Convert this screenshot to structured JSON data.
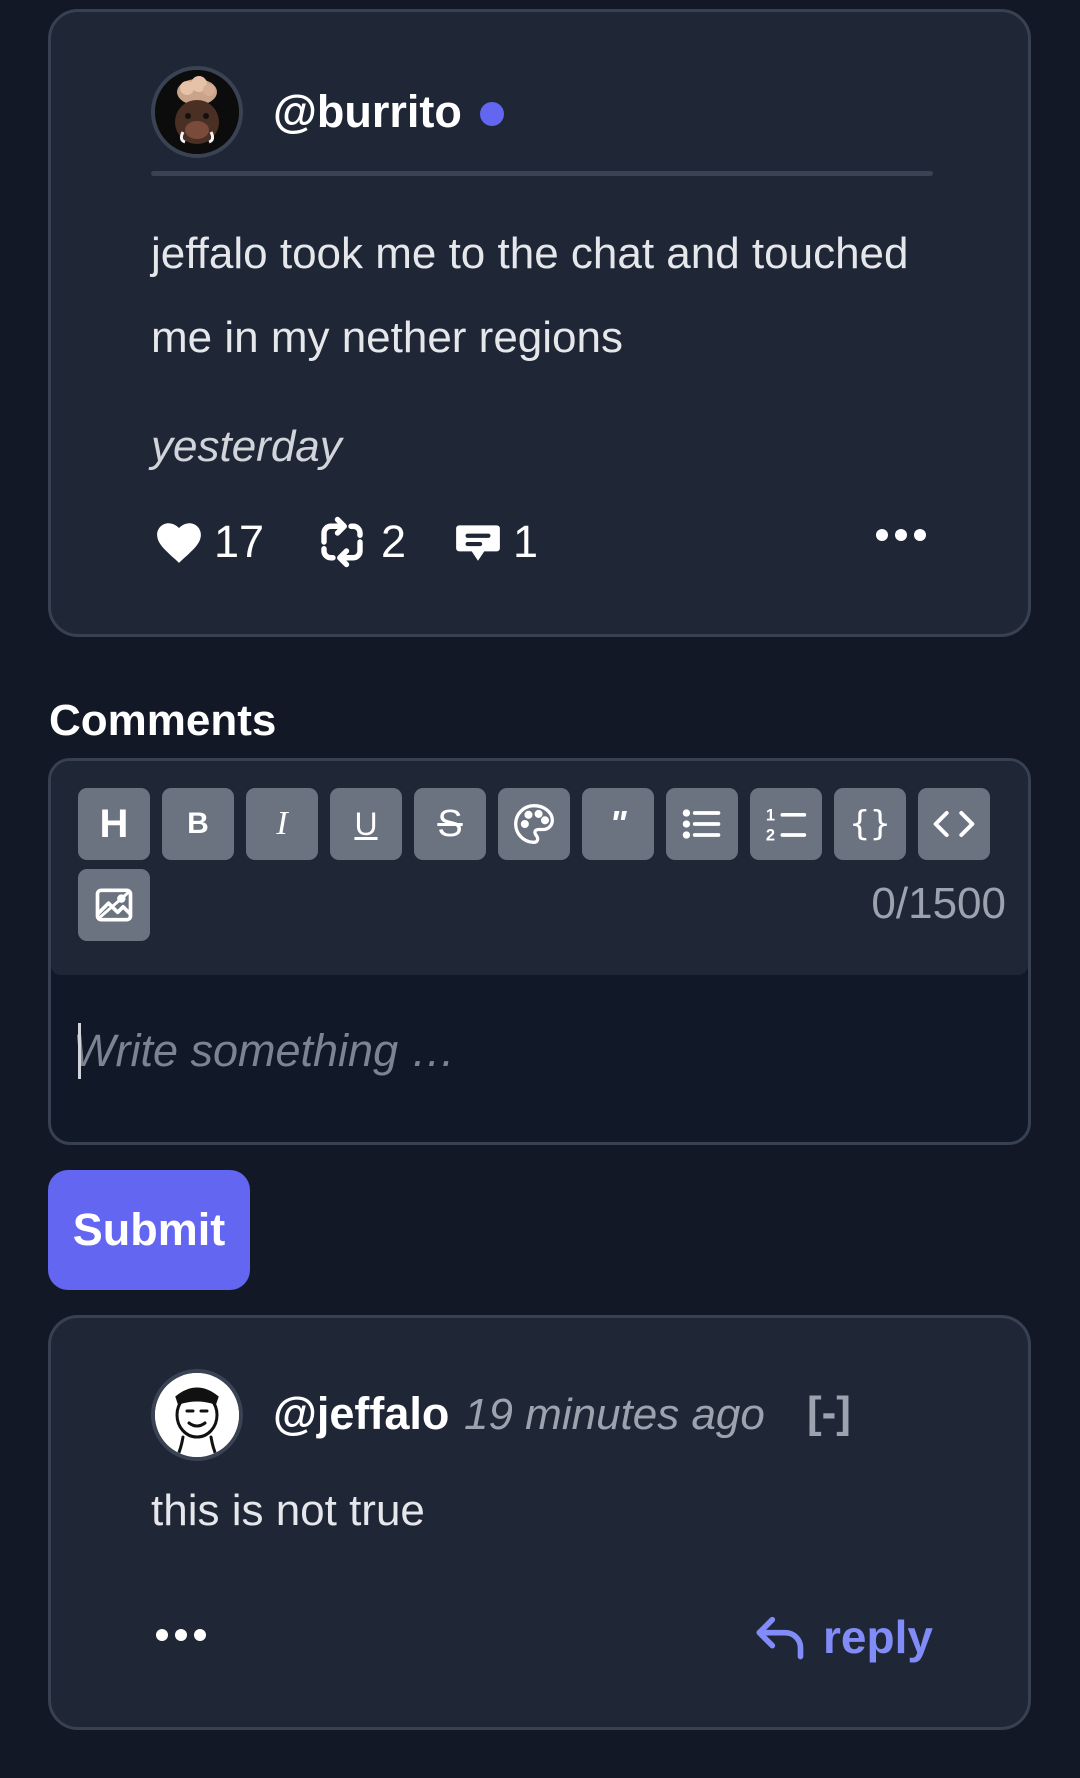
{
  "post": {
    "username": "@burrito",
    "body": "jeffalo took me to the chat and touched me in my nether regions",
    "time": "yesterday",
    "likes": "17",
    "reposts": "2",
    "comments": "1"
  },
  "comments_section": {
    "heading": "Comments",
    "editor": {
      "toolbar": [
        {
          "name": "heading-button",
          "icon": "H"
        },
        {
          "name": "bold-button",
          "icon": "B"
        },
        {
          "name": "italic-button",
          "icon": "I"
        },
        {
          "name": "underline-button",
          "icon": "U"
        },
        {
          "name": "strikethrough-button",
          "icon": "S"
        },
        {
          "name": "color-palette-button",
          "icon": "palette-icon"
        },
        {
          "name": "quote-button",
          "icon": "quote-icon"
        },
        {
          "name": "bullet-list-button",
          "icon": "list-icon"
        },
        {
          "name": "numbered-list-button",
          "icon": "ordered-list-icon"
        },
        {
          "name": "code-block-button",
          "icon": "{ }"
        },
        {
          "name": "inline-code-button",
          "icon": "code-icon"
        },
        {
          "name": "image-button",
          "icon": "image-icon"
        }
      ],
      "char_count": "0/1500",
      "placeholder": "Write something …"
    },
    "submit_label": "Submit"
  },
  "comment": {
    "username": "@jeffalo",
    "time": "19 minutes ago",
    "collapse": "[-]",
    "body": "this is not true",
    "reply_label": "reply"
  },
  "colors": {
    "background": "#131826",
    "card": "#1f2636",
    "accent": "#6366f1",
    "reply": "#818cf8"
  }
}
